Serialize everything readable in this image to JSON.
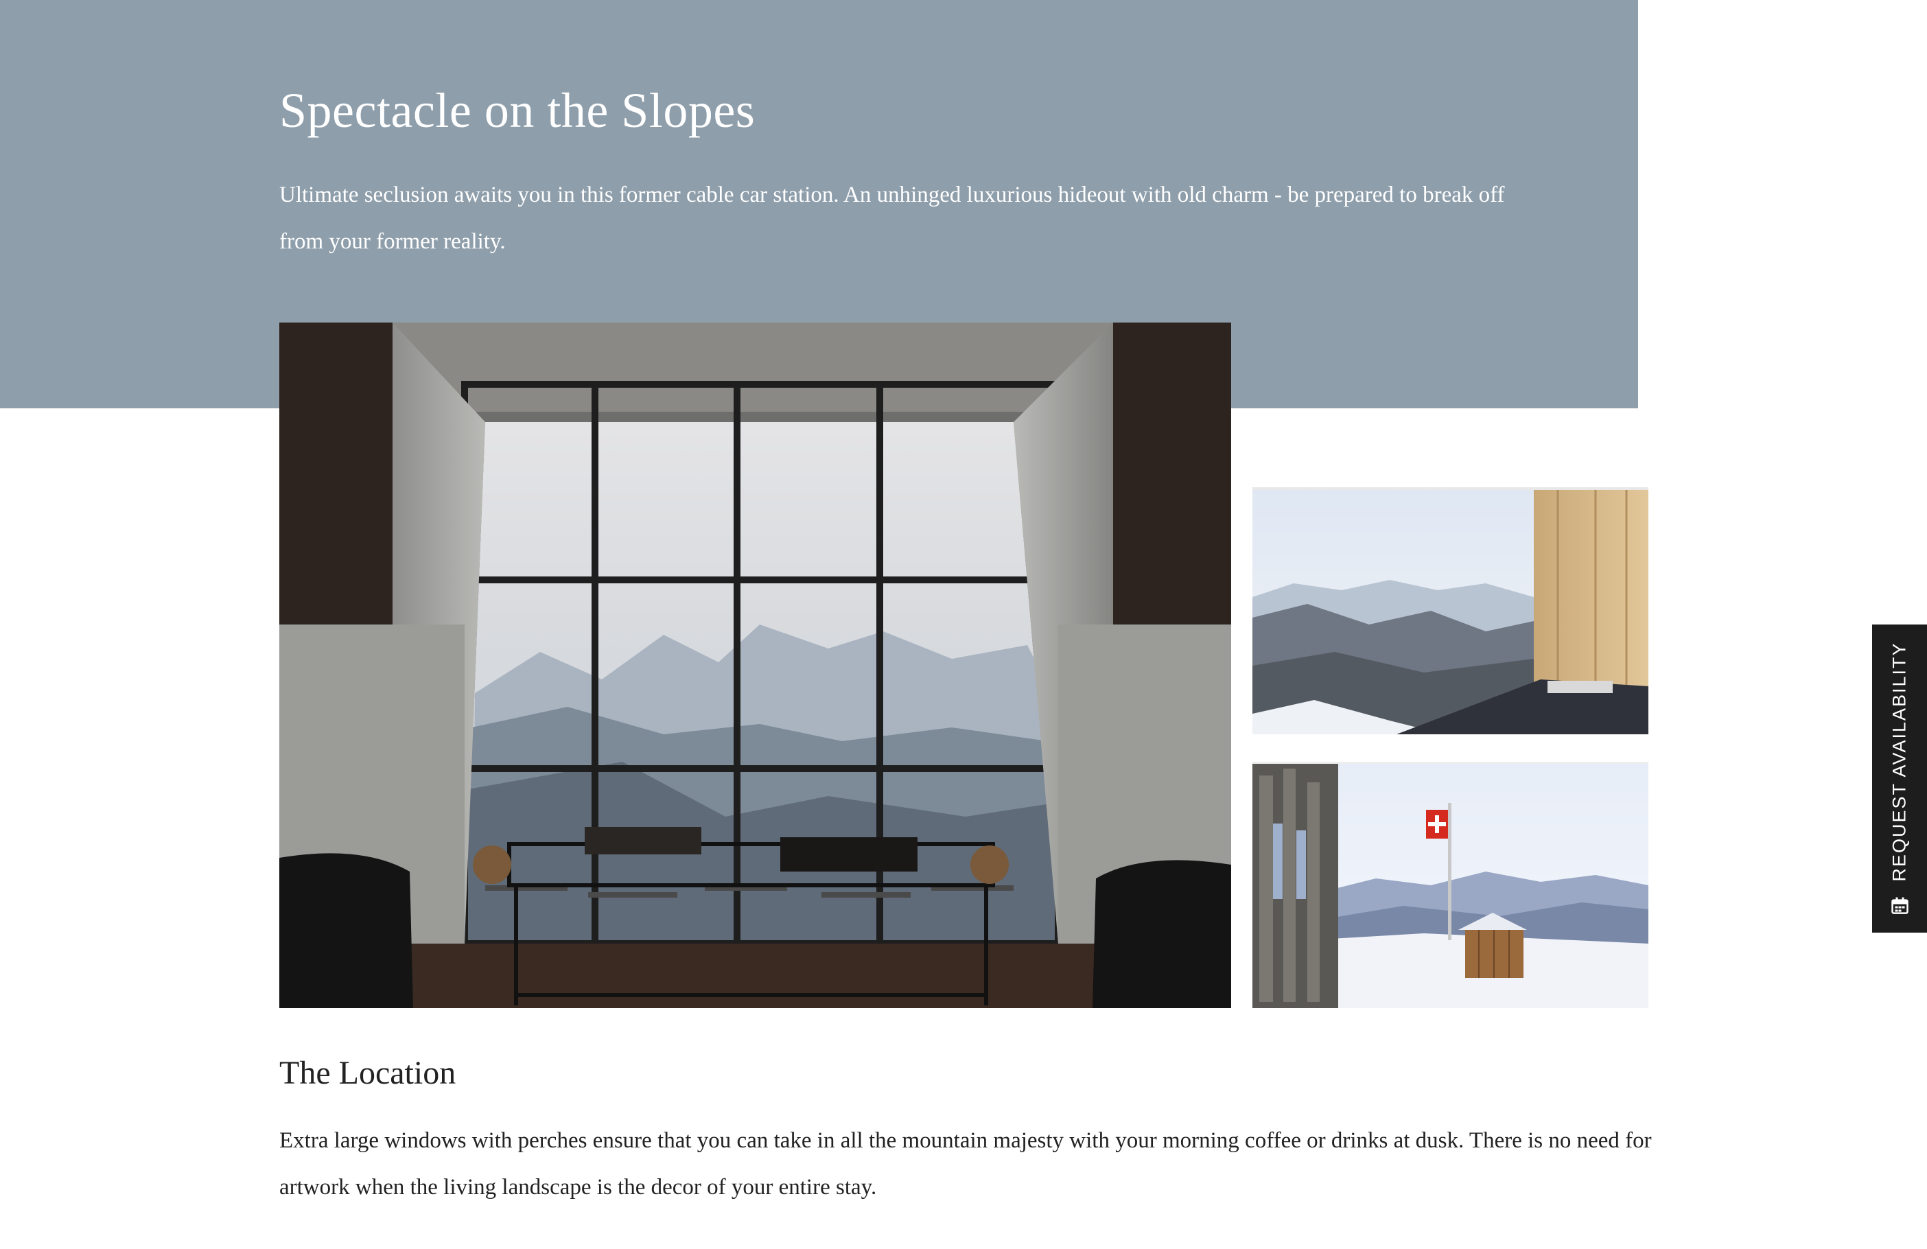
{
  "hero": {
    "title": "Spectacle on the Slopes",
    "intro": "Ultimate seclusion awaits you in this former cable car station. An unhinged luxurious hideout with old charm - be prepared to break off from your former reality."
  },
  "gallery": {
    "main_photo": "photo of lounge with floor-to-ceiling windows overlooking mountains",
    "side_photo_1": "photo of window view over snowy alpine valley",
    "side_photo_2": "photo of stone building with Swiss flag in the snow"
  },
  "location": {
    "heading": "The Location",
    "body": "Extra large windows with perches ensure that you can take in all the mountain majesty with your morning coffee or drinks at dusk. There is no need for artwork when the living landscape is the decor of your entire stay."
  },
  "request_tab": {
    "label": "REQUEST AVAILABILITY",
    "icon": "calendar-icon"
  },
  "colors": {
    "hero_band": "#8e9eab",
    "text_dark": "#222222",
    "tab_background": "#1d1d1d"
  }
}
